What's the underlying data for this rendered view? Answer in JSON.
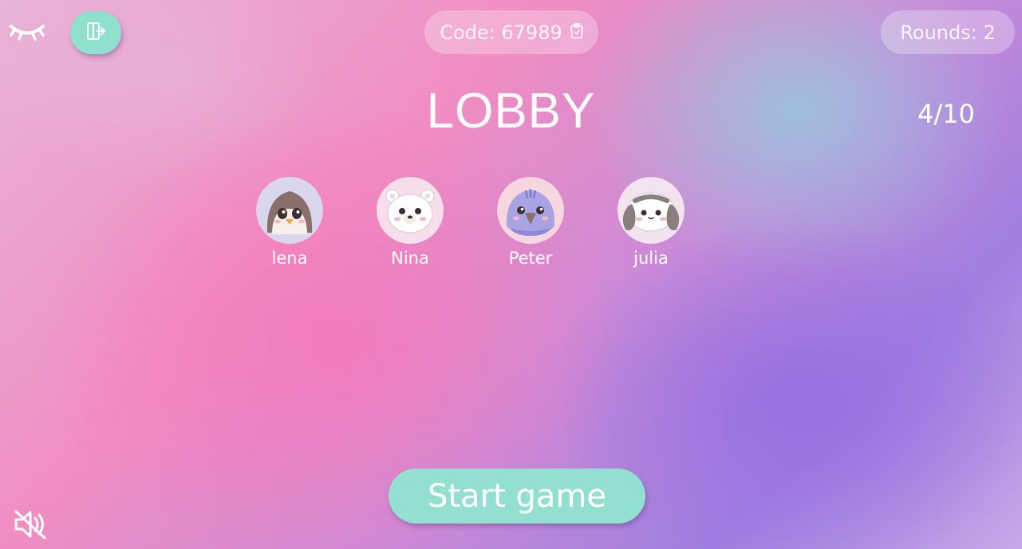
{
  "header": {
    "eye_icon": "closed-eye-icon",
    "switch_icon": "door-exit-icon",
    "code_label": "Code: 67989",
    "copy_icon": "clipboard-icon",
    "rounds_label": "Rounds: 2"
  },
  "lobby": {
    "title": "LOBBY",
    "player_count": "4/10"
  },
  "players": [
    {
      "name": "lena",
      "avatar": "penguin-avatar"
    },
    {
      "name": "Nina",
      "avatar": "polar-bear-avatar"
    },
    {
      "name": "Peter",
      "avatar": "bird-avatar"
    },
    {
      "name": "julia",
      "avatar": "bunny-avatar"
    }
  ],
  "actions": {
    "start_label": "Start game"
  },
  "footer": {
    "sound_icon": "muted-speaker-icon"
  },
  "colors": {
    "accent": "#93e0d3",
    "gradient_pink": "#f08dc2",
    "gradient_purple": "#9f7fe0",
    "gradient_blue": "#96c8de"
  }
}
